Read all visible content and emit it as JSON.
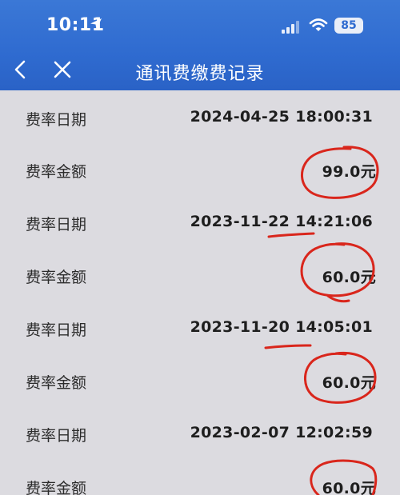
{
  "status_bar": {
    "time": "10:11",
    "battery": "85",
    "icons": [
      "location-arrow-icon",
      "signal-icon",
      "wifi-icon",
      "battery-icon"
    ]
  },
  "nav": {
    "title": "通讯费缴费记录",
    "back_icon": "chevron-left-icon",
    "close_icon": "close-icon"
  },
  "records": [
    {
      "date_label": "费率日期",
      "date": "2024-04-25 18:00:31",
      "amount_label": "费率金额",
      "amount": "99.0元"
    },
    {
      "date_label": "费率日期",
      "date": "2023-11-22 14:21:06",
      "amount_label": "费率金额",
      "amount": "60.0元"
    },
    {
      "date_label": "费率日期",
      "date": "2023-11-20 14:05:01",
      "amount_label": "费率金额",
      "amount": "60.0元"
    },
    {
      "date_label": "费率日期",
      "date": "2023-02-07 12:02:59",
      "amount_label": "费率金额",
      "amount": "60.0元"
    }
  ],
  "colors": {
    "header_blue": "#2f6bd0",
    "background": "#dcdbe0",
    "annotation_red": "#d9261c"
  }
}
